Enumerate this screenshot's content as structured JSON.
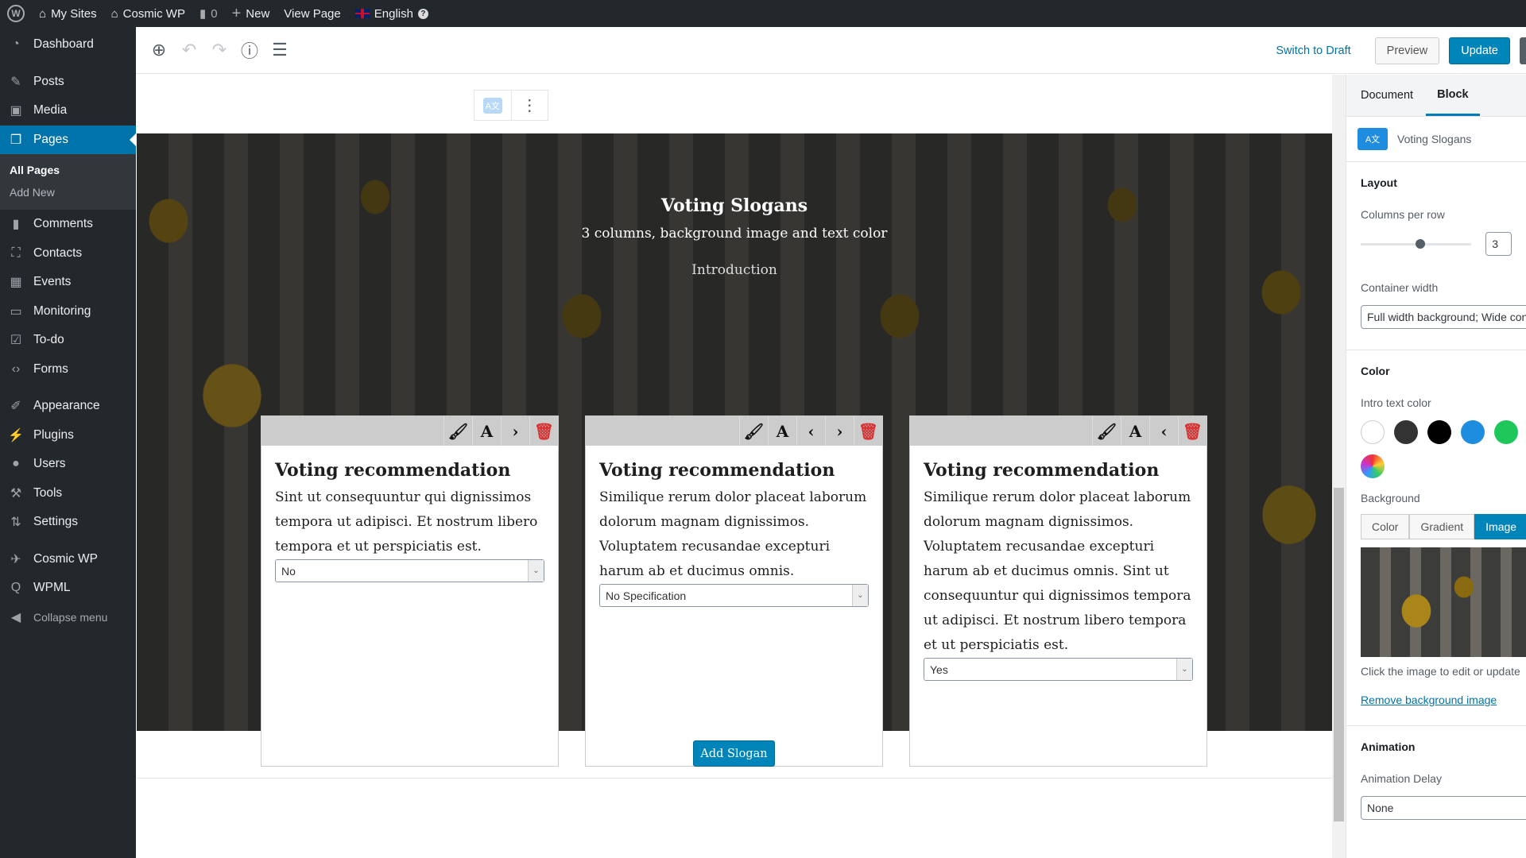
{
  "adminbar": {
    "my_sites": "My Sites",
    "site": "Cosmic WP",
    "comments": "0",
    "new": "New",
    "view_page": "View Page",
    "language": "English"
  },
  "menu": {
    "items": [
      {
        "label": "Dashboard",
        "icon": "dashboard-icon"
      },
      {
        "label": "Posts",
        "icon": "pin-icon"
      },
      {
        "label": "Media",
        "icon": "media-icon"
      },
      {
        "label": "Pages",
        "icon": "pages-icon",
        "active": true
      }
    ],
    "sub": [
      "All Pages",
      "Add New"
    ],
    "items2": [
      {
        "label": "Comments",
        "icon": "comment-icon"
      },
      {
        "label": "Contacts",
        "icon": "contacts-icon"
      },
      {
        "label": "Events",
        "icon": "events-icon"
      },
      {
        "label": "Monitoring",
        "icon": "monitor-icon"
      },
      {
        "label": "To-do",
        "icon": "todo-icon"
      },
      {
        "label": "Forms",
        "icon": "forms-icon"
      }
    ],
    "items3": [
      {
        "label": "Appearance"
      },
      {
        "label": "Plugins"
      },
      {
        "label": "Users"
      },
      {
        "label": "Tools"
      },
      {
        "label": "Settings"
      }
    ],
    "items4": [
      {
        "label": "Cosmic WP"
      },
      {
        "label": "WPML"
      },
      {
        "label": "Collapse menu"
      }
    ]
  },
  "toolbar": {
    "switch_draft": "Switch to Draft",
    "preview": "Preview",
    "update": "Update"
  },
  "block": {
    "title": "Voting Slogans",
    "subtitle": "3 columns, background image and text color",
    "intro": "Introduction",
    "add_button": "Add Slogan",
    "cards": [
      {
        "heading": "Voting recommendation",
        "text": "Sint ut consequuntur qui dignissimos tempora ut adipisci. Et nostrum libero tempora et ut perspiciatis est.",
        "select": "No"
      },
      {
        "heading": "Voting recommendation",
        "text": "Similique rerum dolor placeat laborum dolorum magnam dignissimos. Voluptatem recusandae excepturi harum ab et ducimus omnis.",
        "select": "No Specification"
      },
      {
        "heading": "Voting recommendation",
        "text": "Similique rerum dolor placeat laborum dolorum magnam dignissimos. Voluptatem recusandae excepturi harum ab et ducimus omnis. Sint ut consequuntur qui dignissimos tempora ut adipisci. Et nostrum libero tempora et ut perspiciatis est.",
        "select": "Yes"
      }
    ]
  },
  "sidebar": {
    "tabs": [
      "Document",
      "Block"
    ],
    "active_tab": "Block",
    "block_name": "Voting Slogans",
    "layout": {
      "heading": "Layout",
      "columns_label": "Columns per row",
      "columns_value": "3",
      "container_label": "Container width",
      "container_value": "Full width background; Wide content"
    },
    "color": {
      "heading": "Color",
      "intro_label": "Intro text color",
      "swatches": [
        "#ffffff",
        "#333333",
        "#000000",
        "#1e8cdf",
        "#1fc75a"
      ],
      "background_label": "Background",
      "bg_options": [
        "Color",
        "Gradient",
        "Image"
      ],
      "bg_selected": "Image",
      "image_hint": "Click the image to edit or update",
      "remove_link": "Remove background image"
    },
    "animation": {
      "heading": "Animation",
      "delay_label": "Animation Delay",
      "delay_value": "None"
    }
  }
}
